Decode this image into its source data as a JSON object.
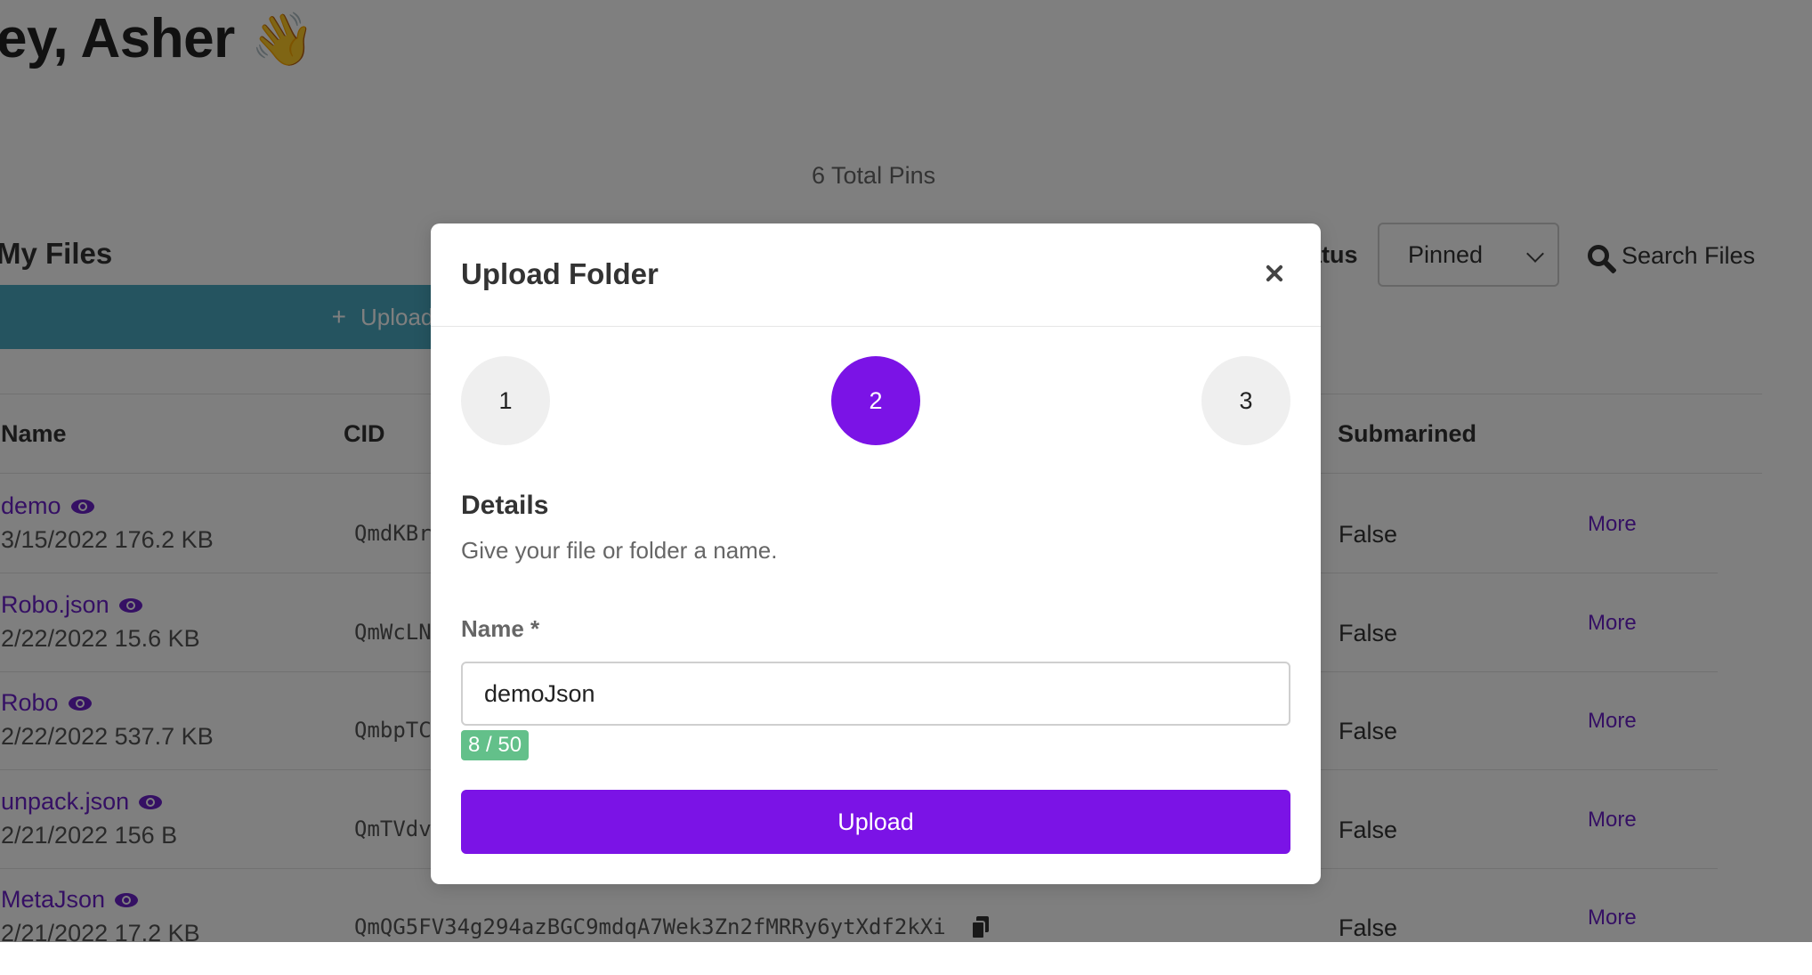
{
  "greeting": {
    "text": "ey, Asher",
    "emoji": "👋"
  },
  "summary": {
    "total_pins": "6 Total Pins"
  },
  "files": {
    "title": "My Files",
    "upload_label": "Upload",
    "status_label": "atus",
    "status_value": "Pinned",
    "search_label": "Search Files",
    "columns": {
      "name": "Name",
      "cid": "CID",
      "submarined": "Submarined"
    },
    "rows": [
      {
        "name": "demo",
        "meta": "3/15/2022 176.2 KB",
        "cid": "QmdKBr",
        "submarined": "False",
        "more": "More"
      },
      {
        "name": "Robo.json",
        "meta": "2/22/2022 15.6 KB",
        "cid": "QmWcLN",
        "submarined": "False",
        "more": "More"
      },
      {
        "name": "Robo",
        "meta": "2/22/2022 537.7 KB",
        "cid": "QmbpTC",
        "submarined": "False",
        "more": "More"
      },
      {
        "name": "unpack.json",
        "meta": "2/21/2022 156 B",
        "cid": "QmTVdv",
        "submarined": "False",
        "more": "More"
      },
      {
        "name": "MetaJson",
        "meta": "2/21/2022 17.2 KB",
        "cid": "QmQG5FV34g294azBGC9mdqA7Wek3Zn2fMRRy6ytXdf2kXi",
        "submarined": "False",
        "more": "More"
      }
    ]
  },
  "modal": {
    "title": "Upload Folder",
    "steps": [
      "1",
      "2",
      "3"
    ],
    "active_step": "2",
    "details_title": "Details",
    "details_subtitle": "Give your file or folder a name.",
    "name_label": "Name *",
    "name_value": "demoJson",
    "char_count": "8 / 50",
    "submit_label": "Upload"
  },
  "colors": {
    "accent": "#7b13e6",
    "link": "#6b21c8",
    "upload_bar": "#4aa8c0",
    "counter_badge": "#63c08a"
  },
  "icons": {
    "wave": "wave-emoji",
    "plus": "plus-icon",
    "search": "search-icon",
    "eye": "eye-icon",
    "copy": "copy-icon",
    "close": "close-icon",
    "chevron": "chevron-down-icon"
  }
}
